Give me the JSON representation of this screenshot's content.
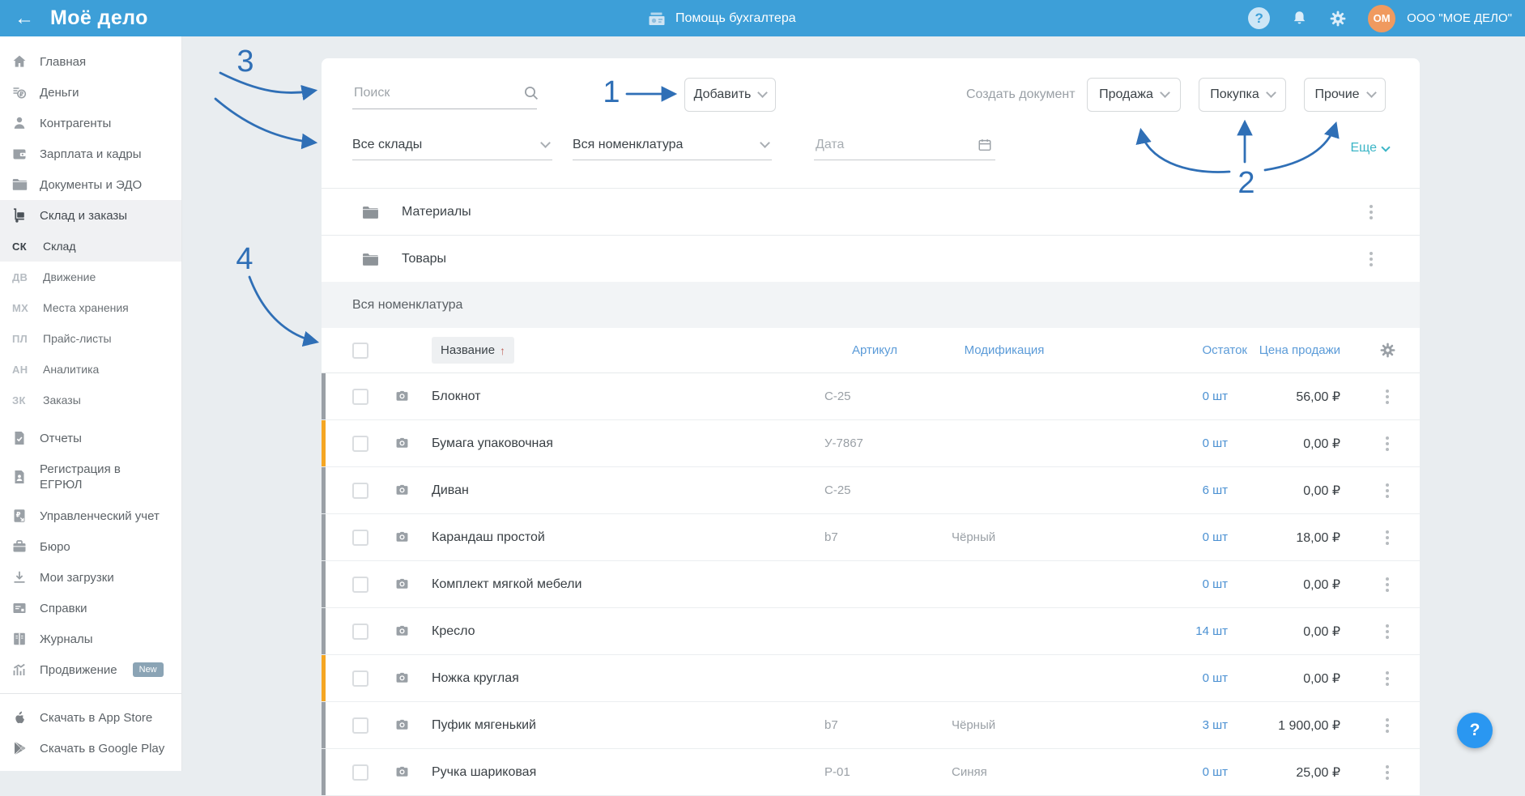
{
  "topbar": {
    "back_arrow": "←",
    "logo": "Моё дело",
    "center_label": "Помощь бухгалтера",
    "help_glyph": "?",
    "avatar_initials": "ОМ",
    "company": "ООО \"МОЕ ДЕЛО\""
  },
  "sidebar": {
    "items": [
      {
        "icon": "home-icon",
        "label": "Главная"
      },
      {
        "icon": "money-icon",
        "label": "Деньги"
      },
      {
        "icon": "contractors-icon",
        "label": "Контрагенты"
      },
      {
        "icon": "salary-icon",
        "label": "Зарплата и кадры"
      },
      {
        "icon": "documents-icon",
        "label": "Документы и ЭДО"
      },
      {
        "icon": "warehouse-icon",
        "label": "Склад и заказы"
      }
    ],
    "subitems": [
      {
        "abbr": "СК",
        "label": "Склад"
      },
      {
        "abbr": "ДВ",
        "label": "Движение"
      },
      {
        "abbr": "МХ",
        "label": "Места хранения"
      },
      {
        "abbr": "ПЛ",
        "label": "Прайс-листы"
      },
      {
        "abbr": "АН",
        "label": "Аналитика"
      },
      {
        "abbr": "ЗК",
        "label": "Заказы"
      }
    ],
    "items2": [
      {
        "icon": "reports-icon",
        "label": "Отчеты"
      },
      {
        "icon": "egrul-icon",
        "label": "Регистрация в ЕГРЮЛ"
      },
      {
        "icon": "management-icon",
        "label": "Управленческий учет"
      },
      {
        "icon": "bureau-icon",
        "label": "Бюро"
      },
      {
        "icon": "downloads-icon",
        "label": "Мои загрузки"
      },
      {
        "icon": "certificates-icon",
        "label": "Справки"
      },
      {
        "icon": "journals-icon",
        "label": "Журналы"
      },
      {
        "icon": "promotion-icon",
        "label": "Продвижение",
        "badge": "New"
      }
    ],
    "footer": [
      {
        "icon": "apple-icon",
        "label": "Скачать в App Store"
      },
      {
        "icon": "google-play-icon",
        "label": "Скачать в Google Play"
      }
    ]
  },
  "toolbar": {
    "search_placeholder": "Поиск",
    "add_label": "Добавить",
    "create_document_label": "Создать документ",
    "sale_label": "Продажа",
    "purchase_label": "Покупка",
    "other_label": "Прочие",
    "more_label": "Еще"
  },
  "filters": {
    "warehouse_value": "Все склады",
    "nomenclature_value": "Вся номенклатура",
    "date_placeholder": "Дата"
  },
  "folders": [
    {
      "name": "Материалы"
    },
    {
      "name": "Товары"
    }
  ],
  "section_title": "Вся номенклатура",
  "table": {
    "headers": {
      "name": "Название",
      "sort_indicator": "↑",
      "sku": "Артикул",
      "modification": "Модификация",
      "stock": "Остаток",
      "price": "Цена продажи"
    },
    "rows": [
      {
        "name": "Блокнот",
        "sku": "С-25",
        "mod": "",
        "stock": "0 шт",
        "price": "56,00 ₽",
        "bar": "#9aa0a6"
      },
      {
        "name": "Бумага упаковочная",
        "sku": "У-7867",
        "mod": "",
        "stock": "0 шт",
        "price": "0,00 ₽",
        "bar": "#f5a623"
      },
      {
        "name": "Диван",
        "sku": "С-25",
        "mod": "",
        "stock": "6 шт",
        "price": "0,00 ₽",
        "bar": "#9aa0a6"
      },
      {
        "name": "Карандаш простой",
        "sku": "b7",
        "mod": "Чёрный",
        "stock": "0 шт",
        "price": "18,00 ₽",
        "bar": "#9aa0a6"
      },
      {
        "name": "Комплект мягкой мебели",
        "sku": "",
        "mod": "",
        "stock": "0 шт",
        "price": "0,00 ₽",
        "bar": "#9aa0a6"
      },
      {
        "name": "Кресло",
        "sku": "",
        "mod": "",
        "stock": "14 шт",
        "price": "0,00 ₽",
        "bar": "#9aa0a6"
      },
      {
        "name": "Ножка круглая",
        "sku": "",
        "mod": "",
        "stock": "0 шт",
        "price": "0,00 ₽",
        "bar": "#f5a623"
      },
      {
        "name": "Пуфик мягенький",
        "sku": "b7",
        "mod": "Чёрный",
        "stock": "3 шт",
        "price": "1 900,00 ₽",
        "bar": "#9aa0a6"
      },
      {
        "name": "Ручка шариковая",
        "sku": "Р-01",
        "mod": "Синяя",
        "stock": "0 шт",
        "price": "25,00 ₽",
        "bar": "#9aa0a6"
      }
    ]
  },
  "annotations": {
    "n1": "1",
    "n2": "2",
    "n3": "3",
    "n4": "4"
  },
  "help_fab": "?",
  "colors": {
    "topbar": "#3d9fd8",
    "accent_blue": "#4a90d2",
    "teal_link": "#3bb5c6",
    "annotation_blue": "#2f6fb6",
    "bar_gray": "#9aa0a6",
    "bar_orange": "#f5a623",
    "help_fab_bg": "#2a97f1",
    "avatar_bg": "#f09a5f"
  }
}
